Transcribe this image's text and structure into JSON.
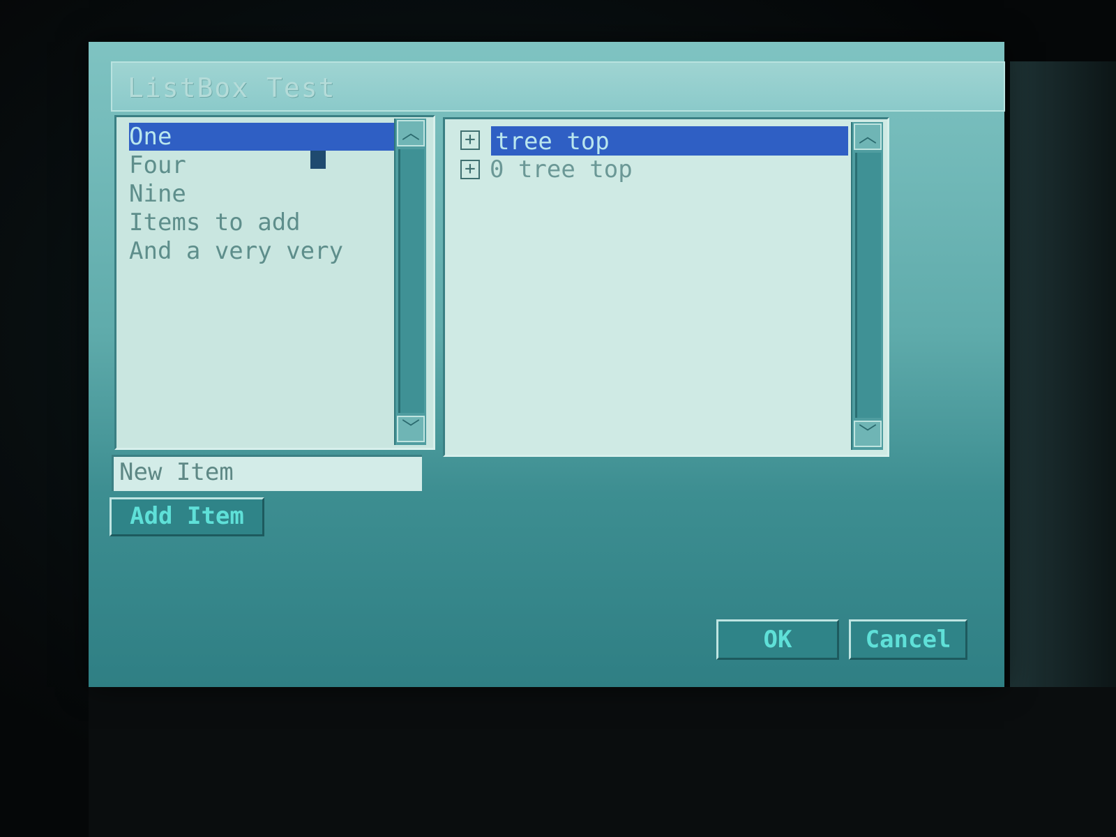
{
  "window": {
    "title": "ListBox Test"
  },
  "listbox": {
    "items": [
      {
        "label": "One",
        "selected": true
      },
      {
        "label": "Four",
        "selected": false
      },
      {
        "label": "Nine",
        "selected": false
      },
      {
        "label": "Items to add",
        "selected": false
      },
      {
        "label": "And a very very",
        "selected": false
      }
    ],
    "scroll_up_icon": "chevron-up-icon",
    "scroll_down_icon": "chevron-down-icon"
  },
  "tree": {
    "nodes": [
      {
        "label": "tree top",
        "expander": "+",
        "selected": true
      },
      {
        "label": "0 tree top",
        "expander": "+",
        "selected": false
      }
    ]
  },
  "new_item": {
    "value": "New Item"
  },
  "buttons": {
    "add_item": "Add Item",
    "ok": "OK",
    "cancel": "Cancel"
  },
  "colors": {
    "selection": "#2f5fc4",
    "window_bg": "#5fabab",
    "button_text": "#5fe0d8"
  }
}
